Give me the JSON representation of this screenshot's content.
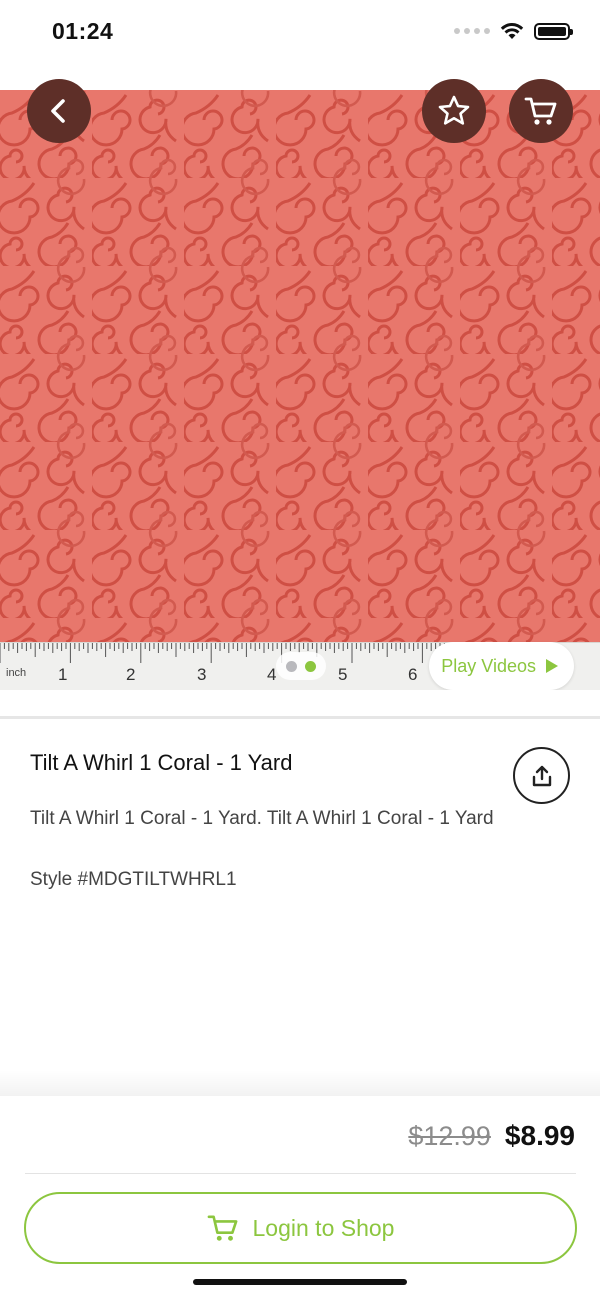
{
  "status_bar": {
    "time": "01:24"
  },
  "product": {
    "title": "Tilt A Whirl 1 Coral - 1 Yard",
    "description": "Tilt A Whirl 1 Coral - 1 Yard. Tilt A Whirl 1 Coral - 1 Yard",
    "style": "Style #MDGTILTWHRL1",
    "price_original": "$12.99",
    "price_sale": "$8.99"
  },
  "image": {
    "ruler_unit": "inch",
    "ruler_numbers": [
      "1",
      "2",
      "3",
      "4",
      "5",
      "6"
    ],
    "play_videos_label": "Play Videos",
    "carousel_total": 2,
    "carousel_active": 2
  },
  "actions": {
    "login_label": "Login to Shop"
  },
  "icons": {
    "back": "back-chevron-icon",
    "favorite": "star-icon",
    "cart": "cart-icon",
    "share": "share-icon",
    "play": "play-icon",
    "login_cart": "cart-icon"
  },
  "colors": {
    "accent_green": "#8cc63f",
    "header_button_bg": "#5e2f28",
    "fabric_base": "#e8776c",
    "fabric_swirl": "#cf4f44",
    "carousel_inactive": "#b9b9bd"
  }
}
